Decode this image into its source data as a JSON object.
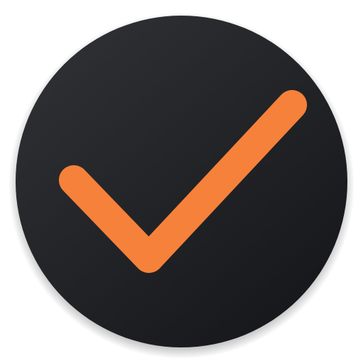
{
  "icon": {
    "name": "checkmark-icon",
    "colors": {
      "circle_light": "#2e2f33",
      "circle_dark": "#16171a",
      "shadow": "#000000",
      "check": "#f6813a"
    }
  }
}
